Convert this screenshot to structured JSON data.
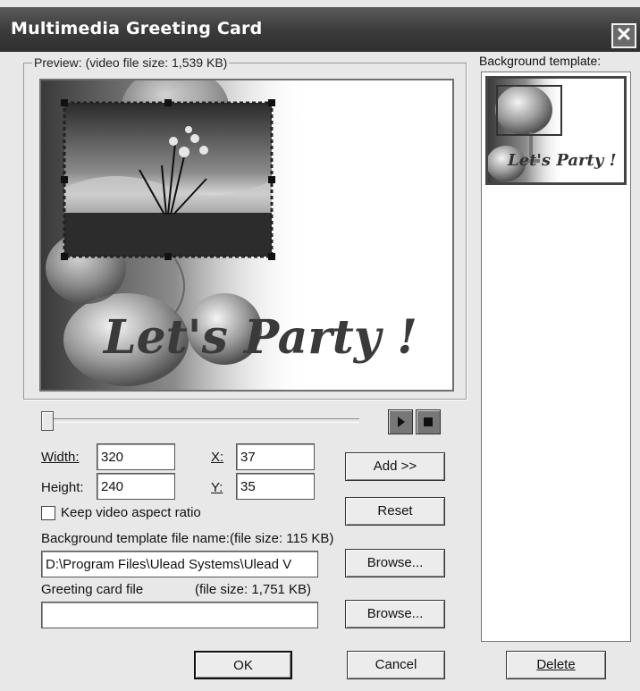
{
  "window": {
    "title": "Multimedia Greeting Card",
    "close_glyph": "✕"
  },
  "preview": {
    "label": "Preview: (video file size: 1,539 KB)",
    "overlay_text": "Let's Party !"
  },
  "templates": {
    "label": "Background template:",
    "items": [
      {
        "text": "Let's Party !"
      }
    ]
  },
  "controls": {
    "width_label": "Width:",
    "width_value": "320",
    "height_label": "Height:",
    "height_value": "240",
    "x_label": "X:",
    "x_value": "37",
    "y_label": "Y:",
    "y_value": "35",
    "keep_aspect_label": "Keep video aspect ratio",
    "keep_aspect_checked": false
  },
  "bg_file": {
    "label": "Background template file name:(file size: 115 KB)",
    "value": "D:\\Program Files\\Ulead Systems\\Ulead V"
  },
  "greeting_file": {
    "label": "Greeting card file",
    "size": "(file size: 1,751 KB)",
    "value": ""
  },
  "buttons": {
    "add": "Add >>",
    "reset": "Reset",
    "browse1": "Browse...",
    "browse2": "Browse...",
    "ok": "OK",
    "cancel": "Cancel",
    "delete": "Delete"
  },
  "icons": {
    "play": "play-icon",
    "stop": "stop-icon",
    "close": "close-icon"
  }
}
